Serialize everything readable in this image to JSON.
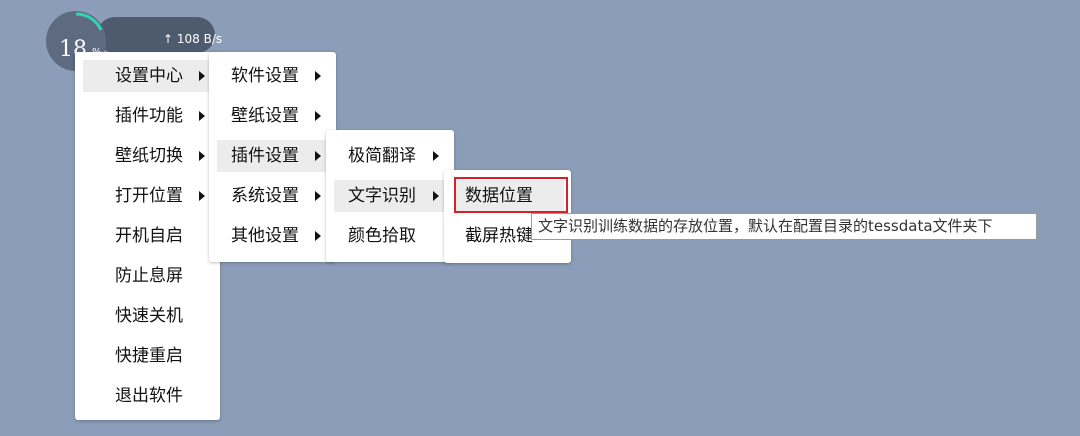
{
  "monitor": {
    "cpu_percent": "18",
    "percent_unit": "%",
    "upload_arrow": "↑",
    "upload_speed": "108 B/s",
    "gauge_color": "#2fd6b0"
  },
  "menus": {
    "main": [
      "设置中心",
      "插件功能",
      "壁纸切换",
      "打开位置",
      "开机自启",
      "防止息屏",
      "快速关机",
      "快捷重启",
      "退出软件"
    ],
    "settings_center": [
      "软件设置",
      "壁纸设置",
      "插件设置",
      "系统设置",
      "其他设置"
    ],
    "plugin_settings": [
      "极简翻译",
      "文字识别",
      "颜色拾取"
    ],
    "ocr": [
      "数据位置",
      "截屏热键"
    ]
  },
  "tooltip": "文字识别训练数据的存放位置，默认在配置目录的tessdata文件夹下",
  "colors": {
    "background": "#8b9db8",
    "highlight": "#ececec",
    "selection_border": "#d8202a"
  }
}
